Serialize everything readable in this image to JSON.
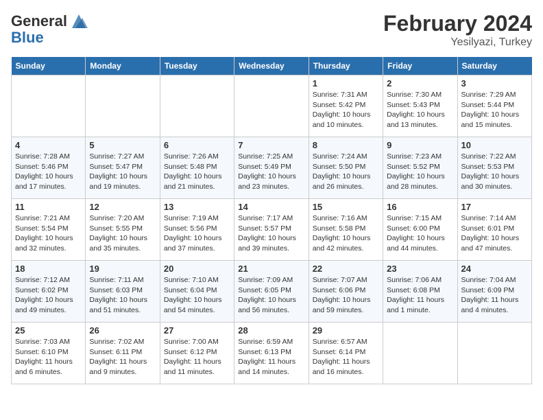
{
  "header": {
    "logo_general": "General",
    "logo_blue": "Blue",
    "month_title": "February 2024",
    "location": "Yesilyazi, Turkey"
  },
  "days_of_week": [
    "Sunday",
    "Monday",
    "Tuesday",
    "Wednesday",
    "Thursday",
    "Friday",
    "Saturday"
  ],
  "weeks": [
    [
      {
        "day": "",
        "sunrise": "",
        "sunset": "",
        "daylight": ""
      },
      {
        "day": "",
        "sunrise": "",
        "sunset": "",
        "daylight": ""
      },
      {
        "day": "",
        "sunrise": "",
        "sunset": "",
        "daylight": ""
      },
      {
        "day": "",
        "sunrise": "",
        "sunset": "",
        "daylight": ""
      },
      {
        "day": "1",
        "sunrise": "Sunrise: 7:31 AM",
        "sunset": "Sunset: 5:42 PM",
        "daylight": "Daylight: 10 hours and 10 minutes."
      },
      {
        "day": "2",
        "sunrise": "Sunrise: 7:30 AM",
        "sunset": "Sunset: 5:43 PM",
        "daylight": "Daylight: 10 hours and 13 minutes."
      },
      {
        "day": "3",
        "sunrise": "Sunrise: 7:29 AM",
        "sunset": "Sunset: 5:44 PM",
        "daylight": "Daylight: 10 hours and 15 minutes."
      }
    ],
    [
      {
        "day": "4",
        "sunrise": "Sunrise: 7:28 AM",
        "sunset": "Sunset: 5:46 PM",
        "daylight": "Daylight: 10 hours and 17 minutes."
      },
      {
        "day": "5",
        "sunrise": "Sunrise: 7:27 AM",
        "sunset": "Sunset: 5:47 PM",
        "daylight": "Daylight: 10 hours and 19 minutes."
      },
      {
        "day": "6",
        "sunrise": "Sunrise: 7:26 AM",
        "sunset": "Sunset: 5:48 PM",
        "daylight": "Daylight: 10 hours and 21 minutes."
      },
      {
        "day": "7",
        "sunrise": "Sunrise: 7:25 AM",
        "sunset": "Sunset: 5:49 PM",
        "daylight": "Daylight: 10 hours and 23 minutes."
      },
      {
        "day": "8",
        "sunrise": "Sunrise: 7:24 AM",
        "sunset": "Sunset: 5:50 PM",
        "daylight": "Daylight: 10 hours and 26 minutes."
      },
      {
        "day": "9",
        "sunrise": "Sunrise: 7:23 AM",
        "sunset": "Sunset: 5:52 PM",
        "daylight": "Daylight: 10 hours and 28 minutes."
      },
      {
        "day": "10",
        "sunrise": "Sunrise: 7:22 AM",
        "sunset": "Sunset: 5:53 PM",
        "daylight": "Daylight: 10 hours and 30 minutes."
      }
    ],
    [
      {
        "day": "11",
        "sunrise": "Sunrise: 7:21 AM",
        "sunset": "Sunset: 5:54 PM",
        "daylight": "Daylight: 10 hours and 32 minutes."
      },
      {
        "day": "12",
        "sunrise": "Sunrise: 7:20 AM",
        "sunset": "Sunset: 5:55 PM",
        "daylight": "Daylight: 10 hours and 35 minutes."
      },
      {
        "day": "13",
        "sunrise": "Sunrise: 7:19 AM",
        "sunset": "Sunset: 5:56 PM",
        "daylight": "Daylight: 10 hours and 37 minutes."
      },
      {
        "day": "14",
        "sunrise": "Sunrise: 7:17 AM",
        "sunset": "Sunset: 5:57 PM",
        "daylight": "Daylight: 10 hours and 39 minutes."
      },
      {
        "day": "15",
        "sunrise": "Sunrise: 7:16 AM",
        "sunset": "Sunset: 5:58 PM",
        "daylight": "Daylight: 10 hours and 42 minutes."
      },
      {
        "day": "16",
        "sunrise": "Sunrise: 7:15 AM",
        "sunset": "Sunset: 6:00 PM",
        "daylight": "Daylight: 10 hours and 44 minutes."
      },
      {
        "day": "17",
        "sunrise": "Sunrise: 7:14 AM",
        "sunset": "Sunset: 6:01 PM",
        "daylight": "Daylight: 10 hours and 47 minutes."
      }
    ],
    [
      {
        "day": "18",
        "sunrise": "Sunrise: 7:12 AM",
        "sunset": "Sunset: 6:02 PM",
        "daylight": "Daylight: 10 hours and 49 minutes."
      },
      {
        "day": "19",
        "sunrise": "Sunrise: 7:11 AM",
        "sunset": "Sunset: 6:03 PM",
        "daylight": "Daylight: 10 hours and 51 minutes."
      },
      {
        "day": "20",
        "sunrise": "Sunrise: 7:10 AM",
        "sunset": "Sunset: 6:04 PM",
        "daylight": "Daylight: 10 hours and 54 minutes."
      },
      {
        "day": "21",
        "sunrise": "Sunrise: 7:09 AM",
        "sunset": "Sunset: 6:05 PM",
        "daylight": "Daylight: 10 hours and 56 minutes."
      },
      {
        "day": "22",
        "sunrise": "Sunrise: 7:07 AM",
        "sunset": "Sunset: 6:06 PM",
        "daylight": "Daylight: 10 hours and 59 minutes."
      },
      {
        "day": "23",
        "sunrise": "Sunrise: 7:06 AM",
        "sunset": "Sunset: 6:08 PM",
        "daylight": "Daylight: 11 hours and 1 minute."
      },
      {
        "day": "24",
        "sunrise": "Sunrise: 7:04 AM",
        "sunset": "Sunset: 6:09 PM",
        "daylight": "Daylight: 11 hours and 4 minutes."
      }
    ],
    [
      {
        "day": "25",
        "sunrise": "Sunrise: 7:03 AM",
        "sunset": "Sunset: 6:10 PM",
        "daylight": "Daylight: 11 hours and 6 minutes."
      },
      {
        "day": "26",
        "sunrise": "Sunrise: 7:02 AM",
        "sunset": "Sunset: 6:11 PM",
        "daylight": "Daylight: 11 hours and 9 minutes."
      },
      {
        "day": "27",
        "sunrise": "Sunrise: 7:00 AM",
        "sunset": "Sunset: 6:12 PM",
        "daylight": "Daylight: 11 hours and 11 minutes."
      },
      {
        "day": "28",
        "sunrise": "Sunrise: 6:59 AM",
        "sunset": "Sunset: 6:13 PM",
        "daylight": "Daylight: 11 hours and 14 minutes."
      },
      {
        "day": "29",
        "sunrise": "Sunrise: 6:57 AM",
        "sunset": "Sunset: 6:14 PM",
        "daylight": "Daylight: 11 hours and 16 minutes."
      },
      {
        "day": "",
        "sunrise": "",
        "sunset": "",
        "daylight": ""
      },
      {
        "day": "",
        "sunrise": "",
        "sunset": "",
        "daylight": ""
      }
    ]
  ]
}
